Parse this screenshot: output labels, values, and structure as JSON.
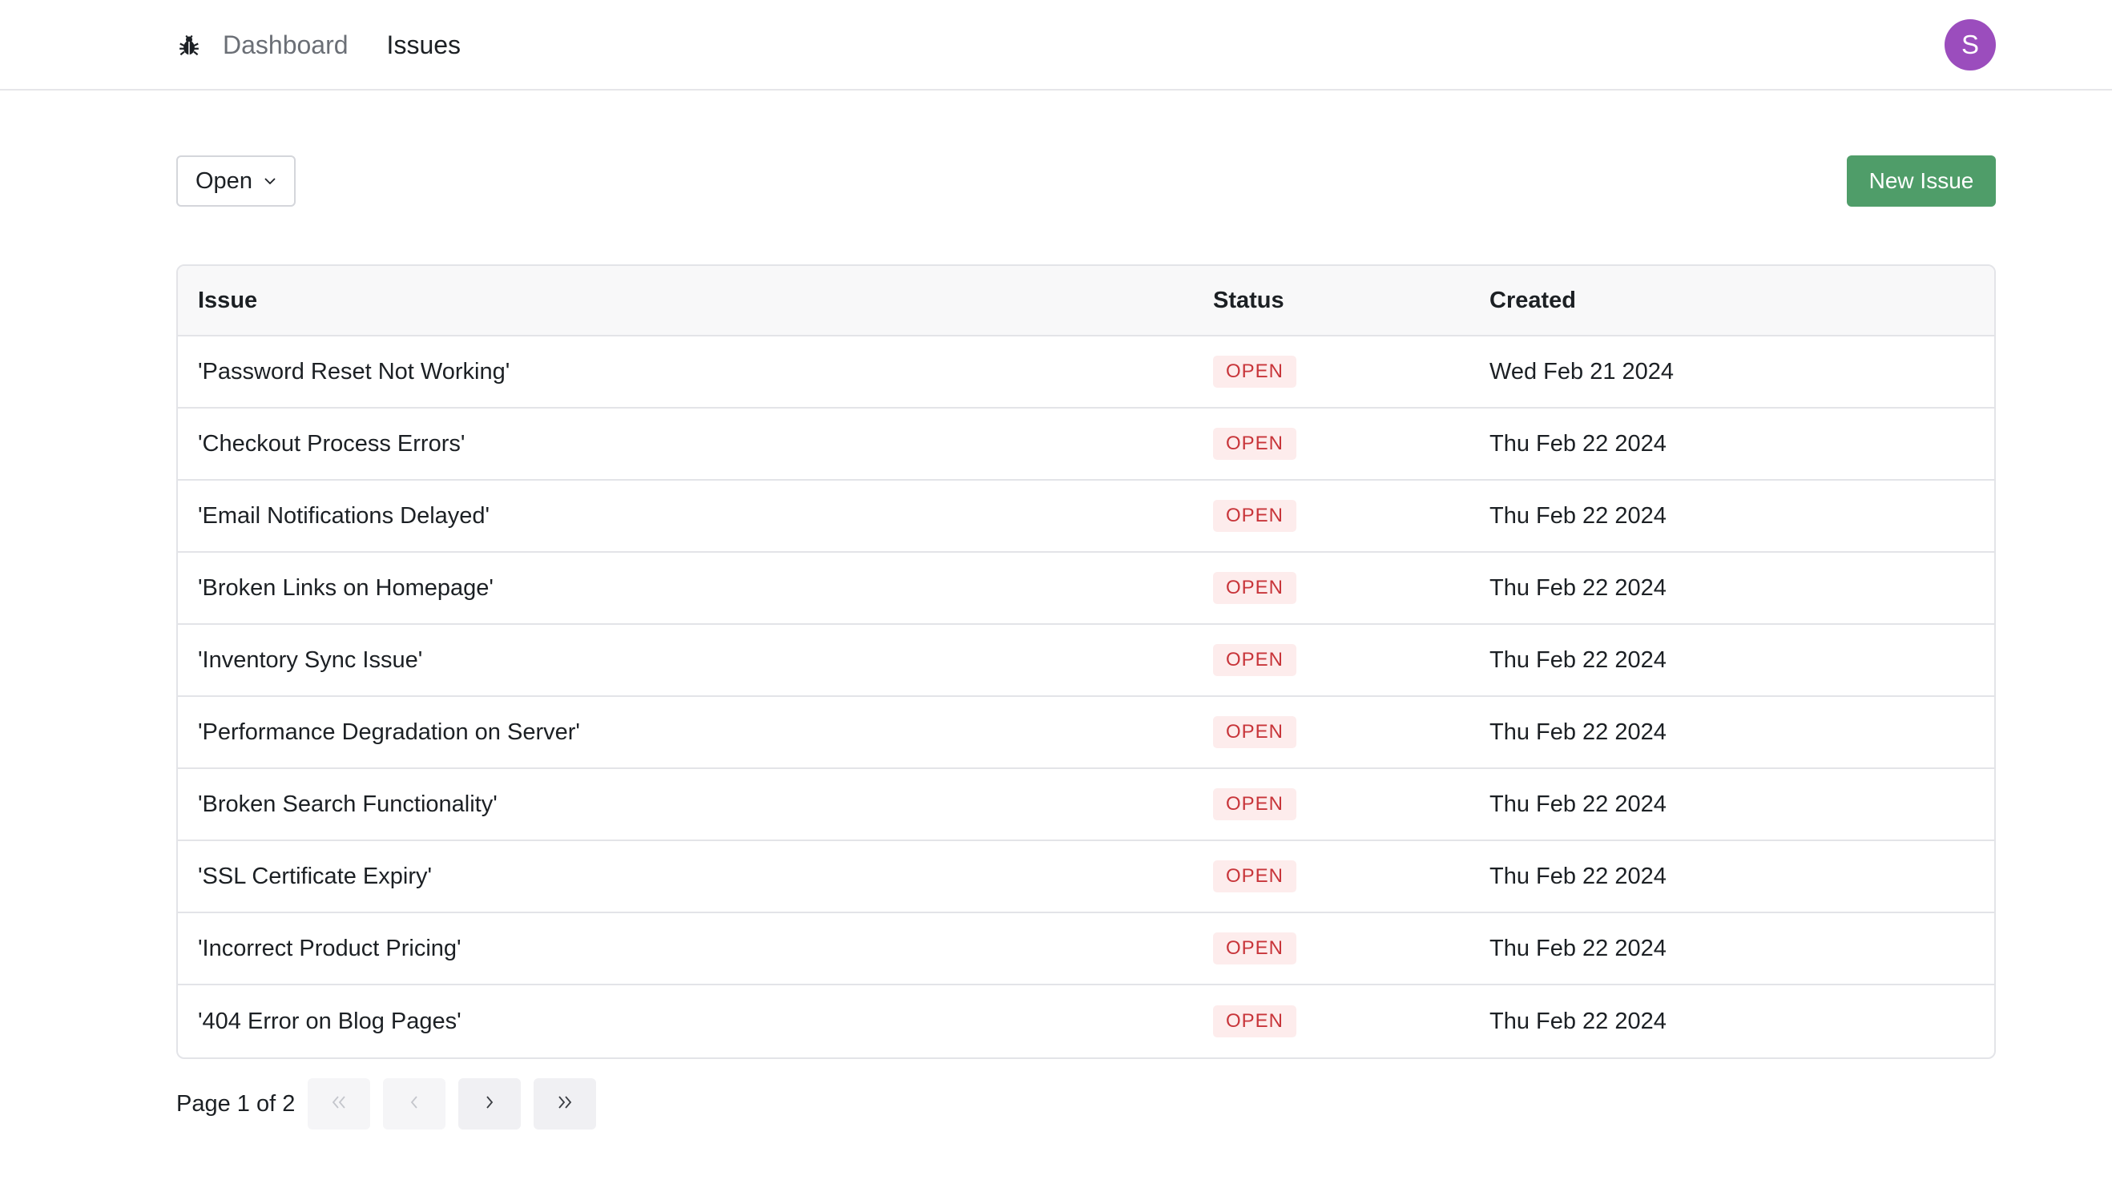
{
  "nav": {
    "logo_icon": "bug-icon",
    "links": [
      {
        "label": "Dashboard",
        "active": false
      },
      {
        "label": "Issues",
        "active": true
      }
    ],
    "avatar_initial": "S",
    "avatar_color": "#9b4dbd"
  },
  "toolbar": {
    "filter_value": "Open",
    "new_issue_label": "New Issue",
    "new_issue_color": "#4f9d69"
  },
  "table": {
    "headers": {
      "issue": "Issue",
      "status": "Status",
      "created": "Created"
    },
    "rows": [
      {
        "issue": "'Password Reset Not Working'",
        "status": "OPEN",
        "created": "Wed Feb 21 2024"
      },
      {
        "issue": "'Checkout Process Errors'",
        "status": "OPEN",
        "created": "Thu Feb 22 2024"
      },
      {
        "issue": "'Email Notifications Delayed'",
        "status": "OPEN",
        "created": "Thu Feb 22 2024"
      },
      {
        "issue": "'Broken Links on Homepage'",
        "status": "OPEN",
        "created": "Thu Feb 22 2024"
      },
      {
        "issue": "'Inventory Sync Issue'",
        "status": "OPEN",
        "created": "Thu Feb 22 2024"
      },
      {
        "issue": "'Performance Degradation on Server'",
        "status": "OPEN",
        "created": "Thu Feb 22 2024"
      },
      {
        "issue": "'Broken Search Functionality'",
        "status": "OPEN",
        "created": "Thu Feb 22 2024"
      },
      {
        "issue": "'SSL Certificate Expiry'",
        "status": "OPEN",
        "created": "Thu Feb 22 2024"
      },
      {
        "issue": "'Incorrect Product Pricing'",
        "status": "OPEN",
        "created": "Thu Feb 22 2024"
      },
      {
        "issue": "'404 Error on Blog Pages'",
        "status": "OPEN",
        "created": "Thu Feb 22 2024"
      }
    ]
  },
  "pagination": {
    "label": "Page 1 of 2",
    "buttons": [
      "first-page",
      "previous-page",
      "next-page",
      "last-page"
    ]
  }
}
